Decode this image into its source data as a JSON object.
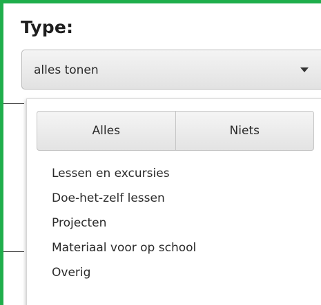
{
  "filter": {
    "label": "Type:",
    "select": {
      "value": "alles tonen",
      "icon": "caret-down-icon"
    },
    "dropdown": {
      "select_all_label": "Alles",
      "select_none_label": "Niets",
      "options": [
        "Lessen en excursies",
        "Doe-het-zelf lessen",
        "Projecten",
        "Materiaal voor op school",
        "Overig"
      ]
    }
  },
  "colors": {
    "frame_border": "#1fae4b",
    "text": "#2a2a2a"
  }
}
